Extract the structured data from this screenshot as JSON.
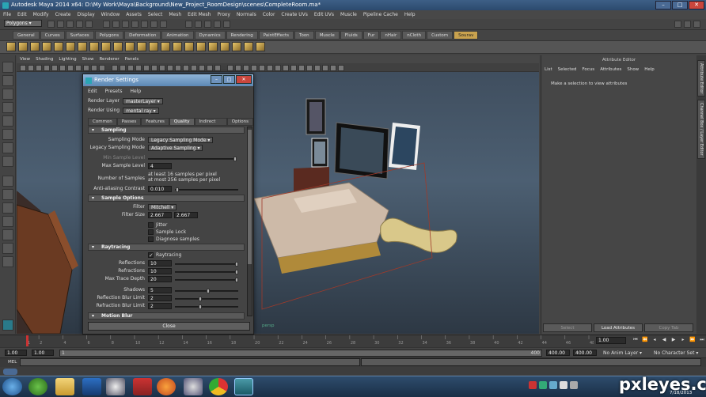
{
  "window": {
    "title": "Autodesk Maya 2014 x64: D:\\My Work\\Maya\\Background\\New_Project_RoomDesign\\scenes\\CompleteRoom.ma*"
  },
  "menubar": [
    "File",
    "Edit",
    "Modify",
    "Create",
    "Display",
    "Window",
    "Assets",
    "Select",
    "Mesh",
    "Edit Mesh",
    "Proxy",
    "Normals",
    "Color",
    "Create UVs",
    "Edit UVs",
    "Muscle",
    "Pipeline Cache",
    "Help"
  ],
  "status": {
    "mode": "Polygons"
  },
  "shelf_tabs": [
    "General",
    "Curves",
    "Surfaces",
    "Polygons",
    "Deformation",
    "Animation",
    "Dynamics",
    "Rendering",
    "PaintEffects",
    "Toon",
    "Muscle",
    "Fluids",
    "Fur",
    "nHair",
    "nCloth",
    "Custom",
    "Sourav"
  ],
  "shelf_active": "Sourav",
  "viewport": {
    "menu": [
      "View",
      "Shading",
      "Lighting",
      "Show",
      "Renderer",
      "Panels"
    ],
    "watermark": "persp"
  },
  "render_settings": {
    "title": "Render Settings",
    "menu": [
      "Edit",
      "Presets",
      "Help"
    ],
    "render_layer_label": "Render Layer",
    "render_layer_value": "masterLayer",
    "render_using_label": "Render Using",
    "render_using_value": "mental ray",
    "tabs": [
      "Common",
      "Passes",
      "Features",
      "Quality",
      "Indirect Lighting",
      "Options"
    ],
    "active_tab": "Quality",
    "sections": {
      "sampling": "Sampling",
      "sample_options": "Sample Options",
      "raytracing": "Raytracing",
      "motion_blur": "Motion Blur"
    },
    "sampling": {
      "mode_label": "Sampling Mode",
      "mode_value": "Legacy Sampling Mode",
      "legacy_label": "Legacy Sampling Mode",
      "legacy_value": "Adaptive Sampling",
      "min_label": "Min Sample Level",
      "max_label": "Max Sample Level",
      "max_value": "4",
      "num_label": "Number of Samples",
      "num_line1": "at least 16 samples per pixel",
      "num_line2": "at most 256 samples per pixel",
      "aa_label": "Anti-aliasing Contrast",
      "aa_value": "0.010"
    },
    "sample_options": {
      "filter_label": "Filter",
      "filter_value": "Mitchell",
      "size_label": "Filter Size",
      "size_x": "2.667",
      "size_y": "2.667",
      "jitter": "Jitter",
      "sample_lock": "Sample Lock",
      "diagnose": "Diagnose samples"
    },
    "raytracing": {
      "raytracing_label": "Raytracing",
      "reflections_label": "Reflections",
      "reflections_value": "10",
      "refractions_label": "Refractions",
      "refractions_value": "10",
      "depth_label": "Max Trace Depth",
      "depth_value": "20",
      "shadows_label": "Shadows",
      "shadows_value": "5",
      "reflblur_label": "Reflection Blur Limit",
      "reflblur_value": "2",
      "refrblur_label": "Refraction Blur Limit",
      "refrblur_value": "2"
    },
    "close_label": "Close"
  },
  "attribute_editor": {
    "title": "Attribute Editor",
    "menu": [
      "List",
      "Selected",
      "Focus",
      "Attributes",
      "Show",
      "Help"
    ],
    "message": "Make a selection to view attributes",
    "buttons": [
      "Select",
      "Load Attributes",
      "Copy Tab"
    ]
  },
  "side_tabs": [
    "Attribute Editor",
    "Channel Box / Layer Editor"
  ],
  "timeline": {
    "ticks": [
      "1",
      "2",
      "4",
      "6",
      "8",
      "10",
      "12",
      "14",
      "16",
      "18",
      "20",
      "22",
      "24",
      "26",
      "28",
      "30",
      "32",
      "34",
      "36",
      "38",
      "40",
      "42",
      "44",
      "46",
      "48"
    ],
    "current": "1.00"
  },
  "range": {
    "start": "1.00",
    "start2": "1.00",
    "frame_box": "1",
    "end_marker": "400",
    "end": "400.00",
    "end2": "400.00",
    "anim_layer": "No Anim Layer",
    "char_set": "No Character Set"
  },
  "command_line": {
    "label": "MEL"
  },
  "taskbar": {
    "date": "7/18/2013"
  },
  "watermark": "pxleyes.com",
  "colors": {
    "title_bar": "#2c4a6e",
    "active_shelf_tab": "#c9a24e",
    "viewport_bg": "#4c5f72"
  }
}
